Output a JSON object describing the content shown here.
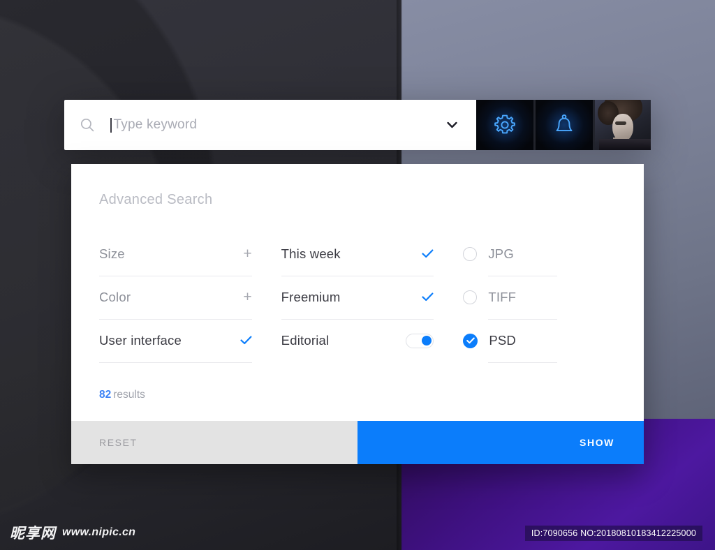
{
  "search": {
    "icon": "search-icon",
    "placeholder": "Type keyword",
    "value": "",
    "dropdown_icon": "chevron-down-icon",
    "actions": [
      {
        "name": "settings",
        "icon": "gear-icon"
      },
      {
        "name": "notifications",
        "icon": "bell-icon"
      },
      {
        "name": "profile",
        "icon": "avatar"
      }
    ]
  },
  "panel": {
    "title": "Advanced Search",
    "columns": [
      {
        "id": "col-attributes",
        "rows": [
          {
            "label": "Size",
            "control": "plus",
            "state": "off"
          },
          {
            "label": "Color",
            "control": "plus",
            "state": "off"
          },
          {
            "label": "User interface",
            "control": "check",
            "state": "on"
          }
        ]
      },
      {
        "id": "col-filters",
        "rows": [
          {
            "label": "This week",
            "control": "check",
            "state": "on"
          },
          {
            "label": "Freemium",
            "control": "check",
            "state": "on"
          },
          {
            "label": "Editorial",
            "control": "toggle",
            "state": "on"
          }
        ]
      },
      {
        "id": "col-formats",
        "rows": [
          {
            "label": "JPG",
            "control": "radio",
            "state": "off"
          },
          {
            "label": "TIFF",
            "control": "radio",
            "state": "off"
          },
          {
            "label": "PSD",
            "control": "checkbox",
            "state": "on"
          }
        ]
      }
    ],
    "results": {
      "count": "82",
      "word": "results"
    },
    "footer": {
      "reset_label": "RESET",
      "show_label": "SHOW"
    }
  },
  "watermark": {
    "logo": "昵享网",
    "url": "www.nipic.cn"
  },
  "id_badge": {
    "text": "ID:7090656 NO:20180810183412225000"
  },
  "colors": {
    "accent_blue": "#0b7dfb",
    "results_blue": "#3d83f5",
    "reset_gray": "#e3e3e3",
    "panel_white": "#ffffff",
    "bg_dark": "#2f2f36",
    "bg_slate": "#7c8298",
    "bg_purple": "#4d18a0"
  }
}
